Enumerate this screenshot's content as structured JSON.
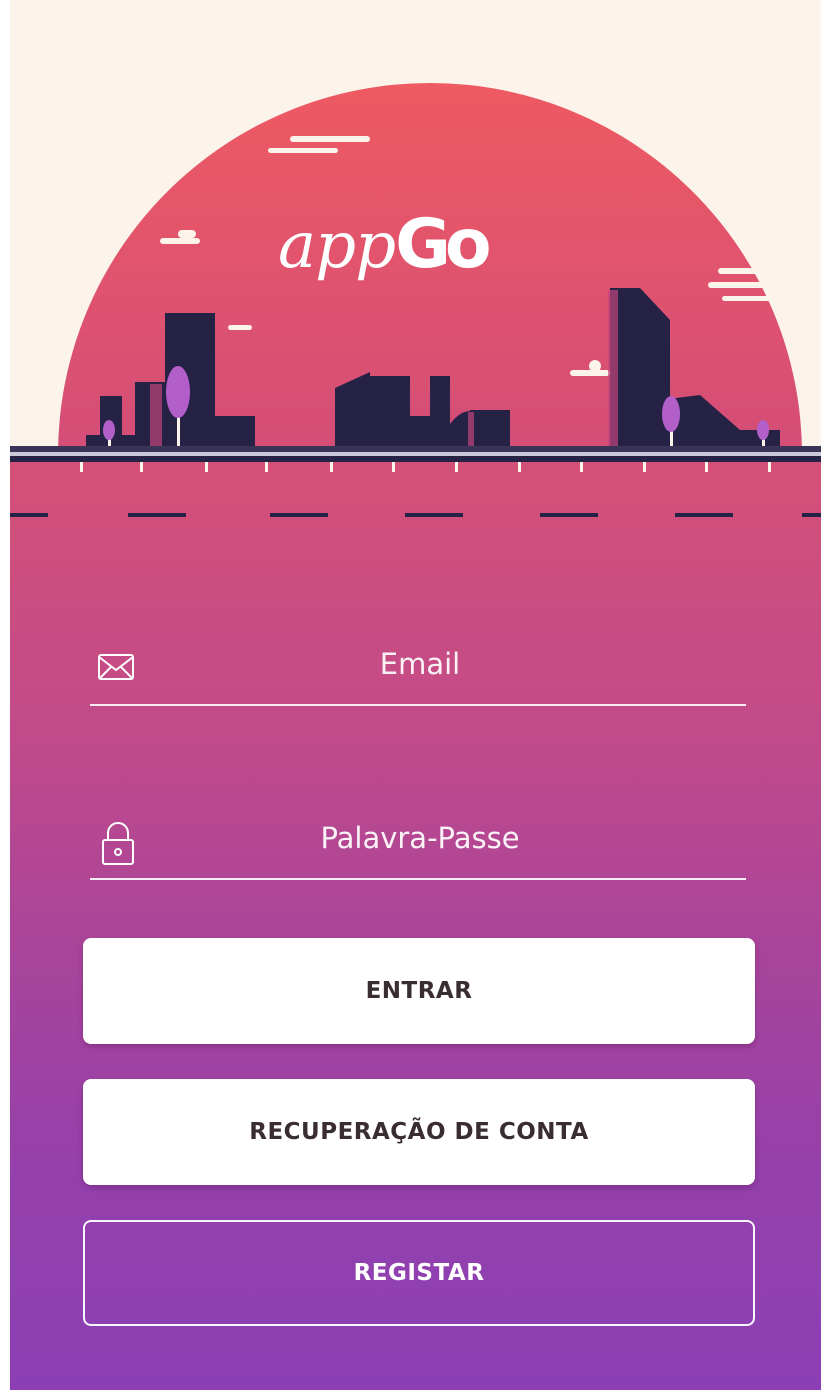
{
  "app": {
    "logo_text_app": "app",
    "logo_text_go": "Go"
  },
  "login": {
    "email_placeholder": "Email",
    "password_placeholder": "Palavra-Passe",
    "login_label": "ENTRAR",
    "recover_label": "RECUPERAÇÃO DE CONTA",
    "register_label": "REGISTAR"
  },
  "icons": {
    "email": "envelope-icon",
    "password": "lock-icon"
  },
  "colors": {
    "sky": "#fcf3ea",
    "sun_top": "#ee5a62",
    "sun_bottom": "#d34d78",
    "buildings": "#262245",
    "background_bottom": "#8c3fb4",
    "button_text": "#3a2c33"
  }
}
